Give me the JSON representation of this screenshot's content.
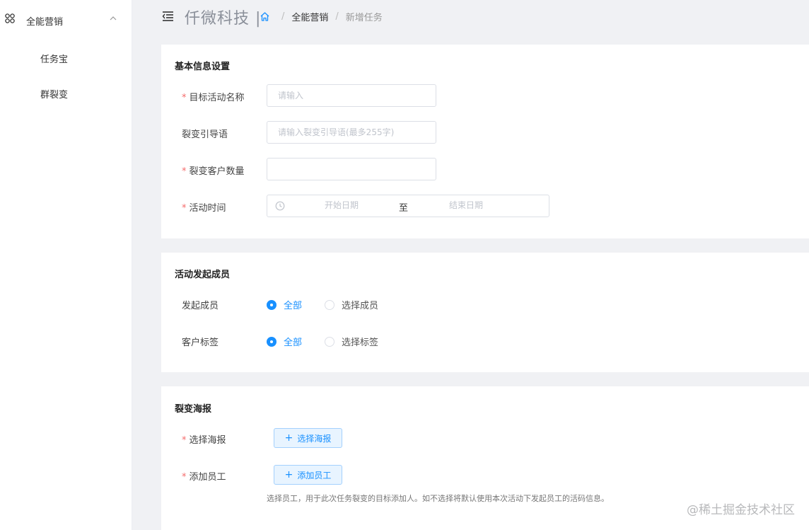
{
  "sidebar": {
    "group": {
      "icon": "grid-icon",
      "label": "全能营销",
      "chevron": "chevron-up-icon"
    },
    "items": [
      {
        "label": "任务宝"
      },
      {
        "label": "群裂变"
      }
    ]
  },
  "header": {
    "brand": "仟微科技 |",
    "breadcrumb": [
      {
        "icon": "home-icon"
      },
      {
        "label": "全能营销"
      },
      {
        "label": "新增任务"
      }
    ]
  },
  "basic": {
    "title": "基本信息设置",
    "activity_name": {
      "label": "目标活动名称",
      "required": "*",
      "placeholder": "请输入",
      "value": ""
    },
    "guide": {
      "label": "裂变引导语",
      "placeholder": "请输入裂变引导语(最多255字)",
      "value": ""
    },
    "count": {
      "label": "裂变客户数量",
      "required": "*",
      "value": ""
    },
    "time": {
      "label": "活动时间",
      "required": "*",
      "start_placeholder": "开始日期",
      "to": "至",
      "end_placeholder": "结束日期"
    }
  },
  "members": {
    "title": "活动发起成员",
    "initiator": {
      "label": "发起成员",
      "options": [
        "全部",
        "选择成员"
      ],
      "selected": "全部"
    },
    "tags": {
      "label": "客户标签",
      "options": [
        "全部",
        "选择标签"
      ],
      "selected": "全部"
    }
  },
  "poster": {
    "title": "裂变海报",
    "select_poster": {
      "label": "选择海报",
      "required": "*",
      "button": "选择海报"
    },
    "add_staff": {
      "label": "添加员工",
      "required": "*",
      "button": "添加员工"
    },
    "hint": "选择员工，用于此次任务裂变的目标添加人。如不选择将默认使用本次活动下发起员工的活码信息。"
  },
  "watermark": "@稀土掘金技术社区",
  "colors": {
    "primary": "#1890ff",
    "required": "#f56c6c",
    "background": "#f0f1f4"
  }
}
